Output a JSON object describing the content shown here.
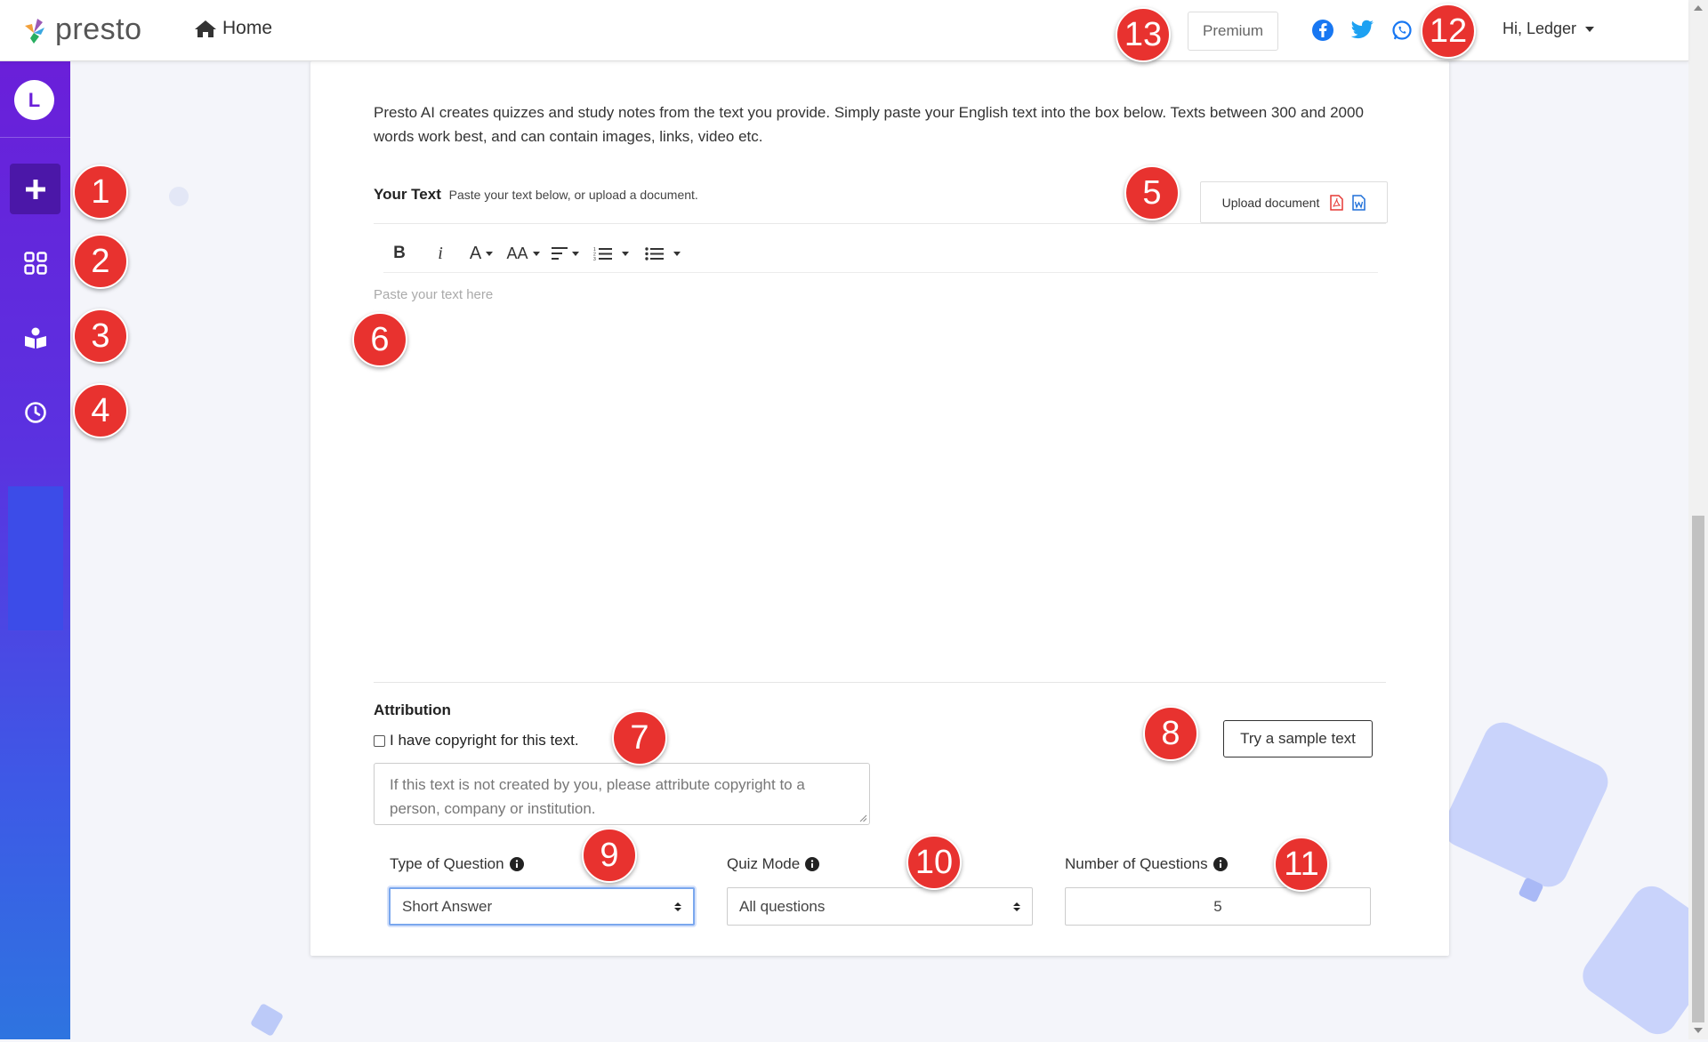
{
  "nav": {
    "logo_text": "presto",
    "home_label": "Home",
    "premium_label": "Premium",
    "user_greeting": "Hi, Ledger"
  },
  "sidebar": {
    "avatar_letter": "L",
    "items": [
      {
        "name": "create",
        "icon": "plus-icon"
      },
      {
        "name": "dashboard",
        "icon": "grid-icon"
      },
      {
        "name": "library",
        "icon": "book-reader-icon"
      },
      {
        "name": "history",
        "icon": "clock-icon"
      }
    ]
  },
  "main": {
    "intro": "Presto AI creates quizzes and study notes from the text you provide. Simply paste your English text into the box below. Texts between 300 and 2000 words work best, and can contain images, links, video etc.",
    "your_text_label": "Your Text",
    "your_text_hint": "Paste your text below, or upload a document.",
    "upload_label": "Upload document",
    "editor_placeholder": "Paste your text here",
    "toolbar": {
      "bold": "B",
      "italic": "i",
      "font_color": "A",
      "font_size": "AA"
    },
    "attribution_label": "Attribution",
    "copyright_checkbox_label": "I have copyright for this text.",
    "attribution_placeholder": "If this text is not created by you, please attribute copyright to a person, company or institution.",
    "sample_button": "Try a sample text",
    "question_type": {
      "label": "Type of Question",
      "value": "Short Answer"
    },
    "quiz_mode": {
      "label": "Quiz Mode",
      "value": "All questions"
    },
    "num_questions": {
      "label": "Number of Questions",
      "value": "5"
    }
  },
  "badges": [
    "1",
    "2",
    "3",
    "4",
    "5",
    "6",
    "7",
    "8",
    "9",
    "10",
    "11",
    "12",
    "13"
  ],
  "colors": {
    "sidebar_top": "#6a1fd9",
    "sidebar_bottom": "#2e74e0",
    "badge": "#e8322f",
    "facebook": "#1877f2",
    "twitter": "#1da1f2",
    "whatsapp": "#1877f2"
  }
}
